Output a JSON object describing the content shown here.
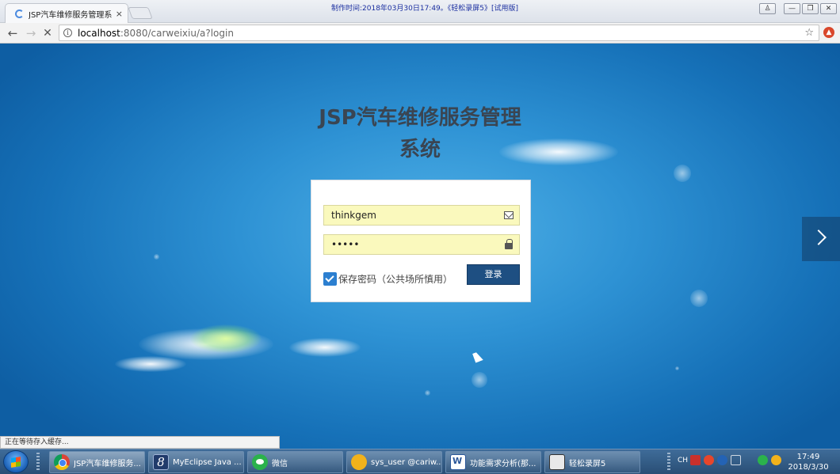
{
  "browser": {
    "tab_title": "JSP汽车维修服务管理系",
    "tab_close": "×",
    "watermark": "制作时间:2018年03月30日17:49｡《轻松录屏5》[试用版]",
    "window_buttons": {
      "user": "♙",
      "minimize": "—",
      "restore": "❐",
      "close": "✕"
    },
    "nav": {
      "back": "←",
      "forward": "→",
      "stop": "✕"
    },
    "url_host": "localhost",
    "url_rest": ":8080/carweixiu/a?login",
    "info_icon": "i",
    "star_icon": "☆",
    "extension_icon": "▲"
  },
  "page": {
    "title_line1": "JSP汽车维修服务管理",
    "title_line2": "系统",
    "login": {
      "username_value": "thinkgem",
      "password_value": "•••••",
      "remember_label": "保存密码（公共场所慎用）",
      "remember_checked": true,
      "submit_label": "登录"
    }
  },
  "status_bar": "正在等待存入缓存...",
  "taskbar": {
    "items": [
      {
        "label": "JSP汽车维修服务...",
        "icon": "chrome-icon"
      },
      {
        "label": "MyEclipse Java ...",
        "icon": "eclipse-icon",
        "glyph": "8"
      },
      {
        "label": "微信",
        "icon": "wechat-icon"
      },
      {
        "label": "sys_user @cariw...",
        "icon": "qq-icon"
      },
      {
        "label": "功能需求分析(那...",
        "icon": "word-icon"
      },
      {
        "label": "轻松录屏5",
        "icon": "recorder-icon"
      }
    ],
    "tray": {
      "lang": "CH"
    },
    "clock_time": "17:49",
    "clock_date": "2018/3/30"
  },
  "colors": {
    "background_blue": "#1e7fc6",
    "login_button": "#1e4f82",
    "field_fill": "#faf9bd",
    "checkbox": "#2c7fd0"
  }
}
